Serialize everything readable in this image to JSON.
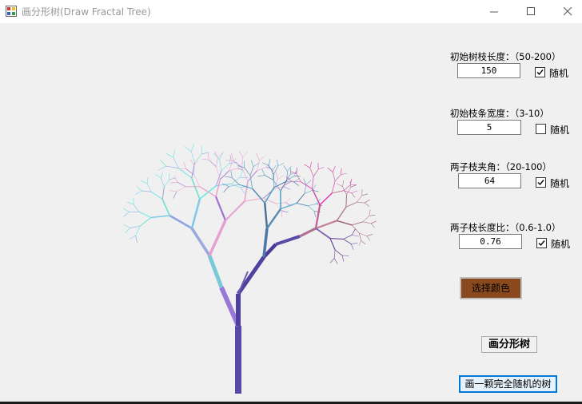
{
  "window": {
    "title": "画分形树(Draw Fractal Tree)"
  },
  "controls": {
    "initial_length": {
      "label": "初始树枝长度：（50-200）",
      "value": "150",
      "random_label": "随机",
      "random_checked": true
    },
    "initial_width": {
      "label": "初始枝条宽度：（3-10）",
      "value": "5",
      "random_label": "随机",
      "random_checked": false
    },
    "branch_angle": {
      "label": "两子枝夹角：（20-100）",
      "value": "64",
      "random_label": "随机",
      "random_checked": true
    },
    "length_ratio": {
      "label": "两子枝长度比：（0.6-1.0）",
      "value": "0.76",
      "random_label": "随机",
      "random_checked": true
    }
  },
  "buttons": {
    "choose_color": "选择颜色",
    "draw_tree": "画分形树",
    "draw_random_tree": "画一颗完全随机的树"
  },
  "colors": {
    "chosen_color": "#8b4a1d",
    "focus_border": "#0078d7"
  }
}
